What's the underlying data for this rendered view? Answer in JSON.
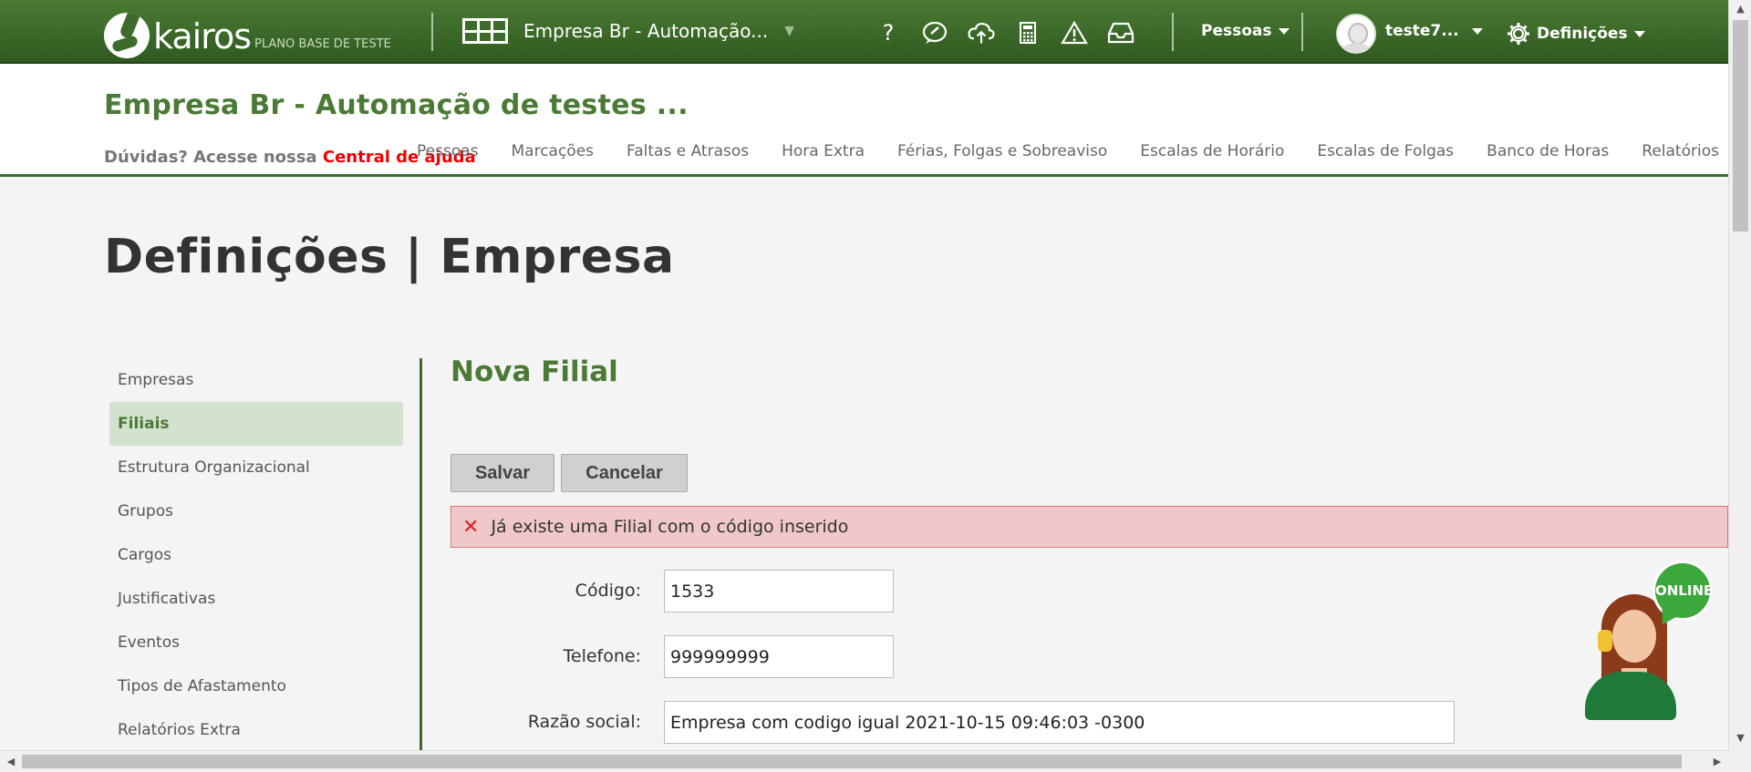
{
  "topbar": {
    "logo_text": "kairos",
    "plan_label": "PLANO BASE DE TESTE",
    "company_select": "Empresa Br - Automação...",
    "icons": [
      "help-icon",
      "feedback-icon",
      "cloud-upload-icon",
      "calculator-icon",
      "warning-icon",
      "inbox-icon"
    ],
    "people_menu": "Pessoas",
    "user_name": "teste7...",
    "settings_menu": "Definições"
  },
  "header": {
    "company_title": "Empresa Br - Automação de testes ...",
    "help_prefix": "Dúvidas? Acesse nossa",
    "help_link": "Central de ajuda",
    "nav": [
      "Pessoas",
      "Marcações",
      "Faltas e Atrasos",
      "Hora Extra",
      "Férias, Folgas e Sobreaviso",
      "Escalas de Horário",
      "Escalas de Folgas",
      "Banco de Horas",
      "Relatórios"
    ]
  },
  "page": {
    "title": "Definições | Empresa"
  },
  "sidebar": {
    "items": [
      {
        "label": "Empresas",
        "active": false
      },
      {
        "label": "Filiais",
        "active": true
      },
      {
        "label": "Estrutura Organizacional",
        "active": false
      },
      {
        "label": "Grupos",
        "active": false
      },
      {
        "label": "Cargos",
        "active": false
      },
      {
        "label": "Justificativas",
        "active": false
      },
      {
        "label": "Eventos",
        "active": false
      },
      {
        "label": "Tipos de Afastamento",
        "active": false
      },
      {
        "label": "Relatórios Extra",
        "active": false
      }
    ]
  },
  "form": {
    "title": "Nova Filial",
    "save_label": "Salvar",
    "cancel_label": "Cancelar",
    "error_message": "Já existe uma Filial com o código inserido",
    "fields": {
      "code_label": "Código:",
      "code_value": "1533",
      "phone_label": "Telefone:",
      "phone_value": "999999999",
      "company_name_label": "Razão social:",
      "company_name_value": "Empresa com codigo igual 2021-10-15 09:46:03 -0300"
    }
  },
  "chat": {
    "status": "ONLINE"
  },
  "colors": {
    "brand_green": "#3e6b2c",
    "title_green": "#4b7a36",
    "error_bg": "#f0c8c9",
    "error_border": "#dc7779",
    "help_link": "#ee0000"
  }
}
